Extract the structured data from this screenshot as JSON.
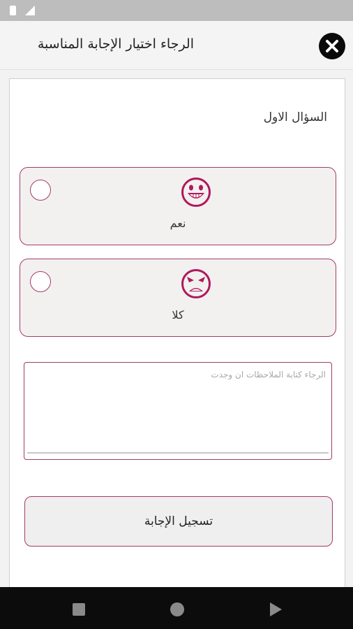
{
  "header": {
    "title": "الرجاء اختيار الإجابة المناسبة",
    "close_icon": "close-icon"
  },
  "question": {
    "title": "السؤال الاول"
  },
  "options": [
    {
      "label": "نعم",
      "icon": "happy-face-icon",
      "selected": false
    },
    {
      "label": "كلا",
      "icon": "angry-face-icon",
      "selected": false
    }
  ],
  "notes": {
    "placeholder": "الرجاء كتابة الملاحظات ان وجدت",
    "value": ""
  },
  "submit": {
    "label": "تسجيل الإجابة"
  },
  "colors": {
    "accent": "#a33a6a",
    "face": "#b0185c",
    "header_bg": "#f4f4f4",
    "option_bg": "#f2f1f0"
  },
  "nav": {
    "back_icon": "square-back-icon",
    "home_icon": "circle-home-icon",
    "recent_icon": "triangle-recent-icon"
  }
}
